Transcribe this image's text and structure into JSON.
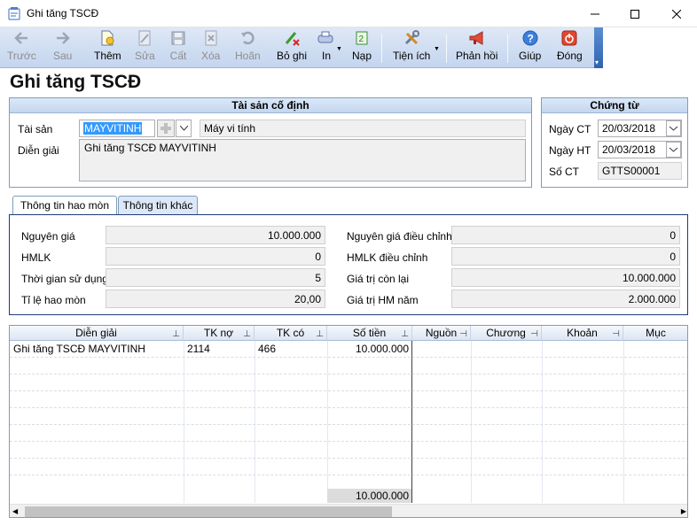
{
  "window": {
    "title": "Ghi tăng TSCĐ"
  },
  "toolbar": {
    "buttons": [
      {
        "id": "prev",
        "label": "Trước",
        "enabled": false,
        "icon": "arrow-left-icon"
      },
      {
        "id": "next",
        "label": "Sau",
        "enabled": false,
        "icon": "arrow-right-icon"
      },
      {
        "id": "add",
        "label": "Thêm",
        "enabled": true,
        "icon": "new-document-icon"
      },
      {
        "id": "edit",
        "label": "Sửa",
        "enabled": false,
        "icon": "edit-icon"
      },
      {
        "id": "save",
        "label": "Cất",
        "enabled": false,
        "icon": "save-icon"
      },
      {
        "id": "delete",
        "label": "Xóa",
        "enabled": false,
        "icon": "delete-icon"
      },
      {
        "id": "undo",
        "label": "Hoãn",
        "enabled": false,
        "icon": "undo-icon"
      },
      {
        "id": "unpost",
        "label": "Bỏ ghi",
        "enabled": true,
        "icon": "unpost-pencil-icon"
      },
      {
        "id": "print",
        "label": "In",
        "enabled": true,
        "icon": "printer-icon"
      },
      {
        "id": "load",
        "label": "Nạp",
        "enabled": true,
        "icon": "load-icon"
      },
      {
        "id": "utilities",
        "label": "Tiện ích",
        "enabled": true,
        "icon": "tools-icon"
      },
      {
        "id": "feedback",
        "label": "Phản hồi",
        "enabled": true,
        "icon": "megaphone-icon"
      },
      {
        "id": "help",
        "label": "Giúp",
        "enabled": true,
        "icon": "help-icon"
      },
      {
        "id": "close",
        "label": "Đóng",
        "enabled": true,
        "icon": "power-icon"
      }
    ]
  },
  "page_title": "Ghi tăng TSCĐ",
  "asset_group": {
    "header": "Tài sản cố định",
    "asset_label": "Tài sản",
    "asset_code": "MAYVITINH",
    "asset_name": "Máy vi tính",
    "desc_label": "Diễn giải",
    "description": "Ghi tăng TSCĐ MAYVITINH"
  },
  "voucher_group": {
    "header": "Chứng từ",
    "voucher_date_label": "Ngày CT",
    "voucher_date": "20/03/2018",
    "posting_date_label": "Ngày HT",
    "posting_date": "20/03/2018",
    "voucher_no_label": "Số CT",
    "voucher_no": "GTTS00001"
  },
  "tabs": [
    {
      "label": "Thông tin hao mòn",
      "active": true
    },
    {
      "label": "Thông tin khác",
      "active": false
    }
  ],
  "depreciation": {
    "original_cost_label": "Nguyên giá",
    "original_cost": "10.000.000",
    "accum_dep_label": "HMLK",
    "accum_dep": "0",
    "useful_life_label": "Thời gian sử dụng",
    "useful_life": "5",
    "dep_rate_label": "Tỉ lệ hao mòn",
    "dep_rate": "20,00",
    "adj_cost_label": "Nguyên giá điều chỉnh",
    "adj_cost": "0",
    "adj_accum_label": "HMLK điều chỉnh",
    "adj_accum": "0",
    "remaining_label": "Giá trị còn lại",
    "remaining": "10.000.000",
    "annual_dep_label": "Giá trị HM năm",
    "annual_dep": "2.000.000"
  },
  "grid": {
    "columns": [
      "Diễn giải",
      "TK nợ",
      "TK có",
      "Số tiền",
      "Nguồn",
      "Chương",
      "Khoản",
      "Mục"
    ],
    "rows": [
      {
        "desc": "Ghi tăng TSCĐ MAYVITINH",
        "debit": "2114",
        "credit": "466",
        "amount": "10.000.000"
      }
    ],
    "total": "10.000.000"
  }
}
